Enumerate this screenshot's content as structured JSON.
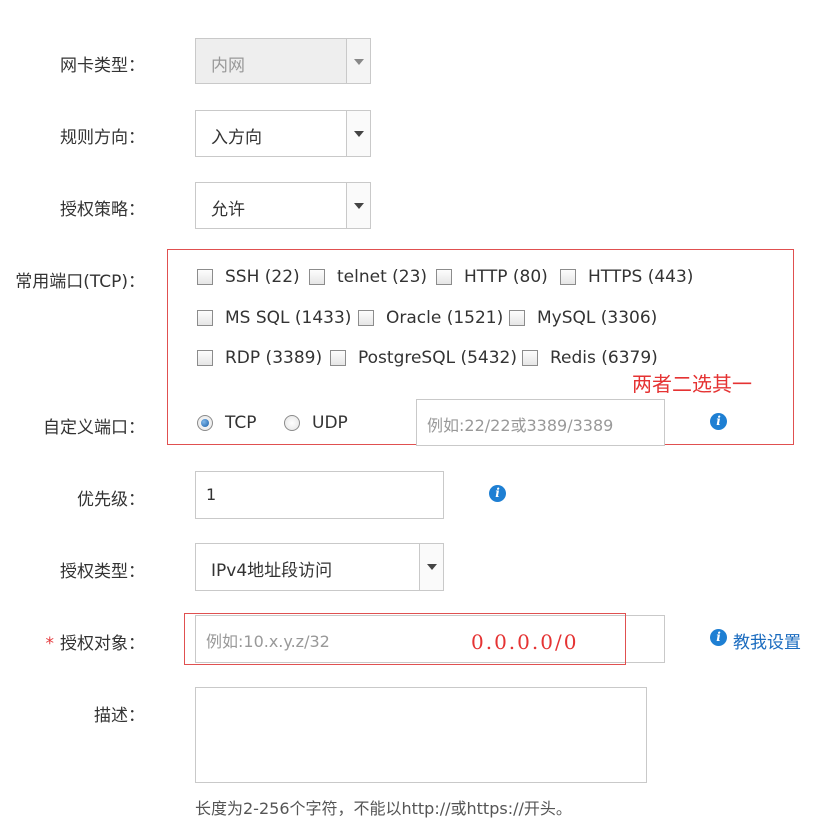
{
  "form": {
    "nic_type": {
      "label": "网卡类型：",
      "value": "内网"
    },
    "direction": {
      "label": "规则方向：",
      "value": "入方向"
    },
    "policy": {
      "label": "授权策略：",
      "value": "允许"
    },
    "common_ports": {
      "label": "常用端口(TCP)：",
      "options": [
        "SSH (22)",
        "telnet (23)",
        "HTTP (80)",
        "HTTPS (443)",
        "MS SQL (1433)",
        "Oracle (1521)",
        "MySQL (3306)",
        "RDP (3389)",
        "PostgreSQL (5432)",
        "Redis (6379)"
      ],
      "checked": []
    },
    "custom_port": {
      "label": "自定义端口：",
      "protocols": [
        "TCP",
        "UDP"
      ],
      "selected_protocol": "TCP",
      "placeholder": "例如:22/22或3389/3389",
      "value": ""
    },
    "priority": {
      "label": "优先级：",
      "value": "1"
    },
    "auth_type": {
      "label": "授权类型：",
      "value": "IPv4地址段访问"
    },
    "auth_object": {
      "label": "授权对象：",
      "required_mark": "*",
      "placeholder": "例如:10.x.y.z/32",
      "value": "",
      "help_link": "教我设置"
    },
    "description": {
      "label": "描述：",
      "value": "",
      "hint": "长度为2-256个字符，不能以http://或https://开头。"
    }
  },
  "annotations": {
    "ports_note": "两者二选其一",
    "auth_object_note": "0.0.0.0/0",
    "color": "#e53333"
  },
  "icons": {
    "info": "info-icon",
    "dropdown": "chevron-down-icon"
  }
}
